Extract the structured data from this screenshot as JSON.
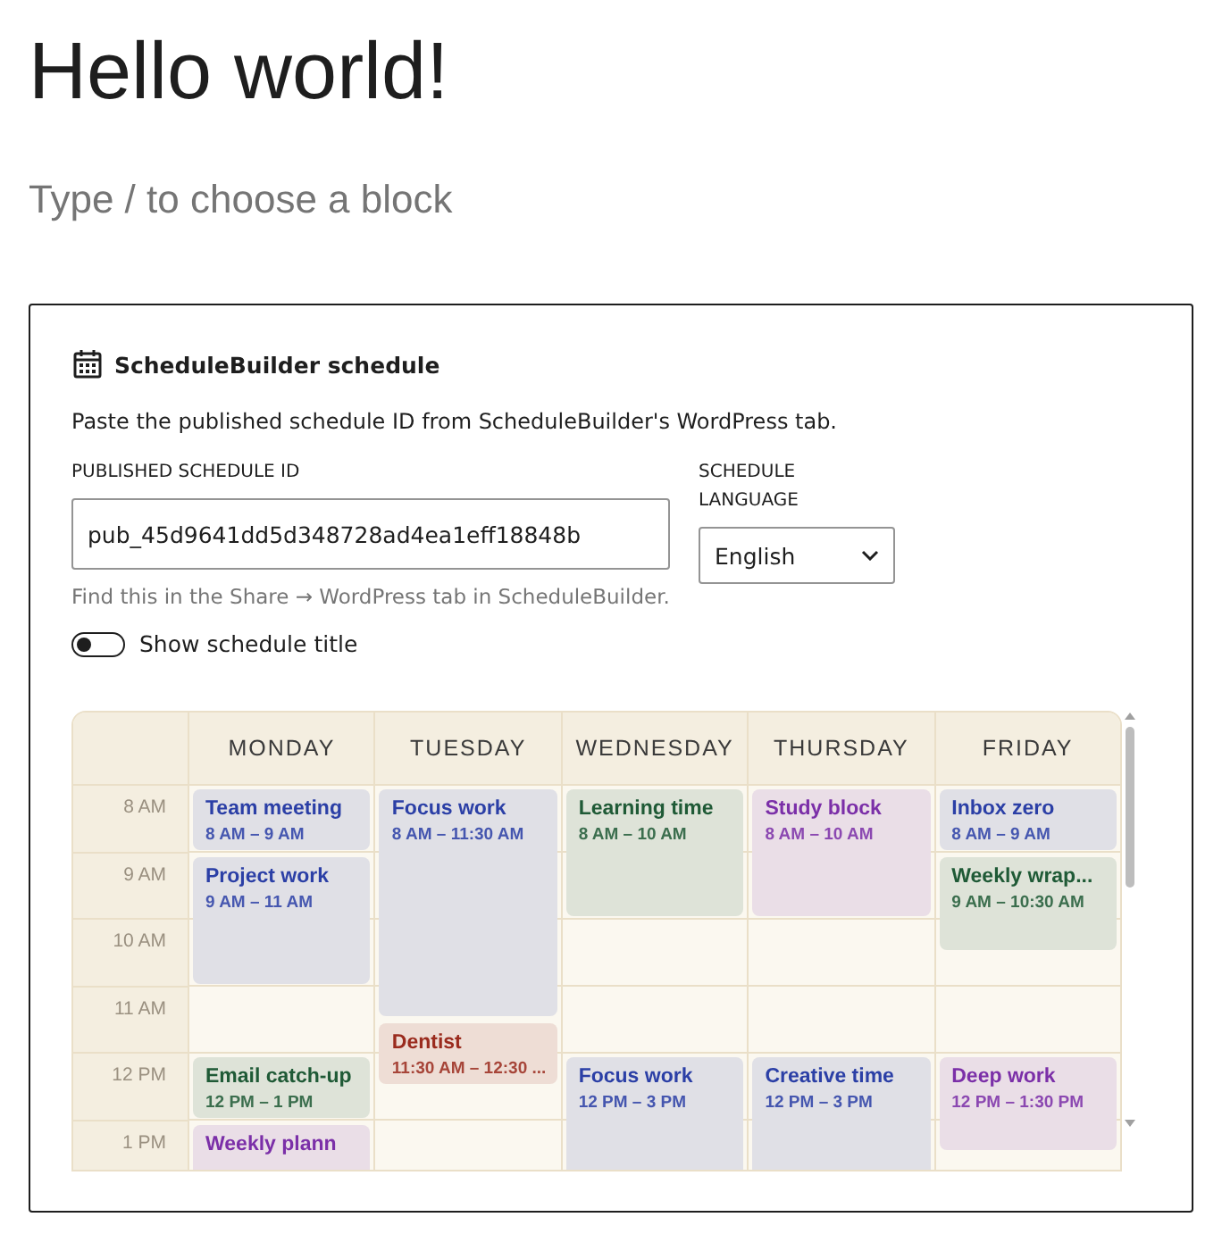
{
  "heading": "Hello world!",
  "block_placeholder": "Type / to choose a block",
  "block": {
    "title": "ScheduleBuilder schedule",
    "description": "Paste the published schedule ID from ScheduleBuilder's WordPress tab.",
    "id_field": {
      "label": "PUBLISHED SCHEDULE ID",
      "value": "pub_45d9641dd5d348728ad4ea1eff18848b",
      "help": "Find this in the Share → WordPress tab in ScheduleBuilder."
    },
    "language_select": {
      "label": "SCHEDULE LANGUAGE",
      "value": "English"
    },
    "show_title_toggle": {
      "label": "Show schedule title",
      "on": false
    },
    "schedule": {
      "hours": [
        "8 AM",
        "9 AM",
        "10 AM",
        "11 AM",
        "12 PM",
        "1 PM"
      ],
      "days": [
        {
          "name": "MONDAY",
          "events": [
            {
              "title": "Team meeting",
              "time": "8 AM – 9 AM",
              "color": "#2b3fa6"
            },
            {
              "title": "Project work",
              "time": "9 AM – 11 AM",
              "color": "#2b3fa6"
            },
            {
              "title": "Email catch-up",
              "time": "12 PM – 1 PM",
              "color": "#1f5a36"
            },
            {
              "title": "Weekly plann",
              "color": "#7b2fa8"
            }
          ]
        },
        {
          "name": "TUESDAY",
          "events": [
            {
              "title": "Focus work",
              "time": "8 AM – 11:30 AM",
              "color": "#2b3fa6"
            },
            {
              "title": "Dentist",
              "time": "11:30 AM – 12:30 ...",
              "color": "#9a2b1e"
            }
          ]
        },
        {
          "name": "WEDNESDAY",
          "events": [
            {
              "title": "Learning time",
              "time": "8 AM – 10 AM",
              "color": "#1f5a36"
            },
            {
              "title": "Focus work",
              "time": "12 PM – 3 PM",
              "color": "#2b3fa6"
            }
          ]
        },
        {
          "name": "THURSDAY",
          "events": [
            {
              "title": "Study block",
              "time": "8 AM – 10 AM",
              "color": "#7b2fa8"
            },
            {
              "title": "Creative time",
              "time": "12 PM – 3 PM",
              "color": "#2b3fa6"
            }
          ]
        },
        {
          "name": "FRIDAY",
          "events": [
            {
              "title": "Inbox zero",
              "time": "8 AM – 9 AM",
              "color": "#2b3fa6"
            },
            {
              "title": "Weekly wrap...",
              "time": "9 AM – 10:30 AM",
              "color": "#1f5a36"
            },
            {
              "title": "Deep work",
              "time": "12 PM – 1:30 PM",
              "color": "#7b2fa8"
            }
          ]
        }
      ]
    }
  }
}
